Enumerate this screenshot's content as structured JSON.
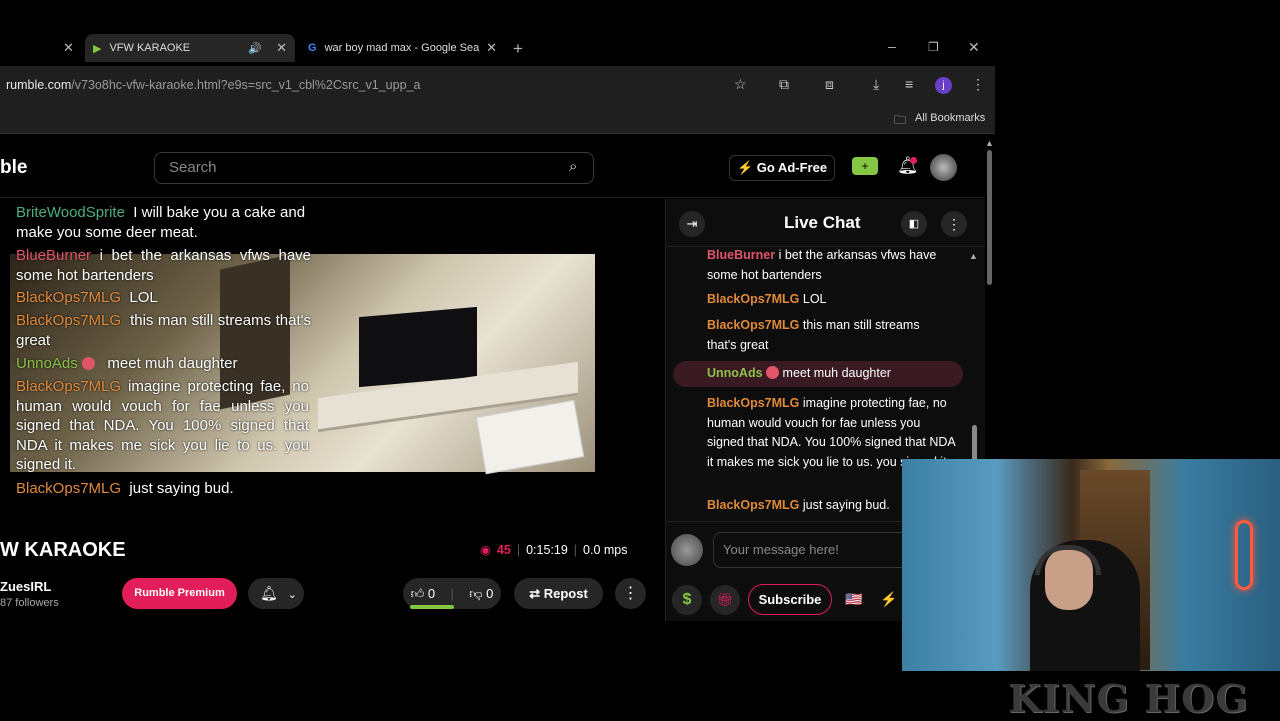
{
  "browser": {
    "tabs": [
      {
        "title": "VFW KARAOKE",
        "active": true
      },
      {
        "title": "war boy mad max - Google Sea",
        "active": false
      }
    ],
    "url_domain": "rumble.com",
    "url_path": "/v73o8hc-vfw-karaoke.html?e9s=src_v1_cbl%2Csrc_v1_upp_a",
    "bookmarks_label": "All Bookmarks",
    "profile_initial": "j"
  },
  "header": {
    "logo": "ble",
    "search_placeholder": "Search",
    "go_ad_free": "Go Ad-Free"
  },
  "video_overlay_chat": [
    {
      "user": "BriteWoodSprite",
      "text": "I will bake you a cake and make you some deer meat.",
      "color": "green"
    },
    {
      "user": "BlueBurner",
      "text": "i bet the arkansas vfws have some hot bartenders",
      "color": "red"
    },
    {
      "user": "BlackOps7MLG",
      "text": "LOL",
      "color": "orange"
    },
    {
      "user": "BlackOps7MLG",
      "text": "this man still streams that's great",
      "color": "orange"
    },
    {
      "user": "UnnoAds",
      "text": "meet muh daughter",
      "color": "lime"
    },
    {
      "user": "BlackOps7MLG",
      "text": "imagine protecting fae, no human would vouch for fae unless you signed that NDA. You 100% signed that NDA it makes me sick you lie to us. you signed it.",
      "color": "orange"
    },
    {
      "user": "BlackOps7MLG",
      "text": "just saying bud.",
      "color": "orange"
    }
  ],
  "video_info": {
    "title": "W KARAOKE",
    "viewers": "45",
    "duration": "0:15:19",
    "bitrate": "0.0 mps",
    "channel": "ZuesIRL",
    "followers": "87 followers",
    "premium_label": "Rumble Premium",
    "likes": "0",
    "dislikes": "0",
    "repost_label": "Repost"
  },
  "chat": {
    "title": "Live Chat",
    "messages": [
      {
        "user": "BlueBurner",
        "text": "i bet the arkansas vfws have some hot bartenders"
      },
      {
        "user": "BlackOps7MLG",
        "text": "LOL"
      },
      {
        "user": "BlackOps7MLG",
        "text": "this man still streams that's great"
      },
      {
        "user": "UnnoAds",
        "text": "meet muh daughter"
      },
      {
        "user": "BlackOps7MLG",
        "text": "imagine protecting fae, no human would vouch for fae unless you signed that NDA. You 100% signed that NDA it makes me sick you lie to us. you signed it."
      },
      {
        "user": "BlackOps7MLG",
        "text": "just saying bud."
      }
    ],
    "input_placeholder": "Your message here!",
    "subscribe_label": "Subscribe"
  },
  "webcam": {
    "overlay_text": "KING HOG"
  },
  "colors": {
    "accent": "#e11d5a",
    "green_user": "#4caf7d",
    "red_user": "#e0556a",
    "orange_user": "#e08a3c",
    "lime_user": "#8bc34a"
  }
}
